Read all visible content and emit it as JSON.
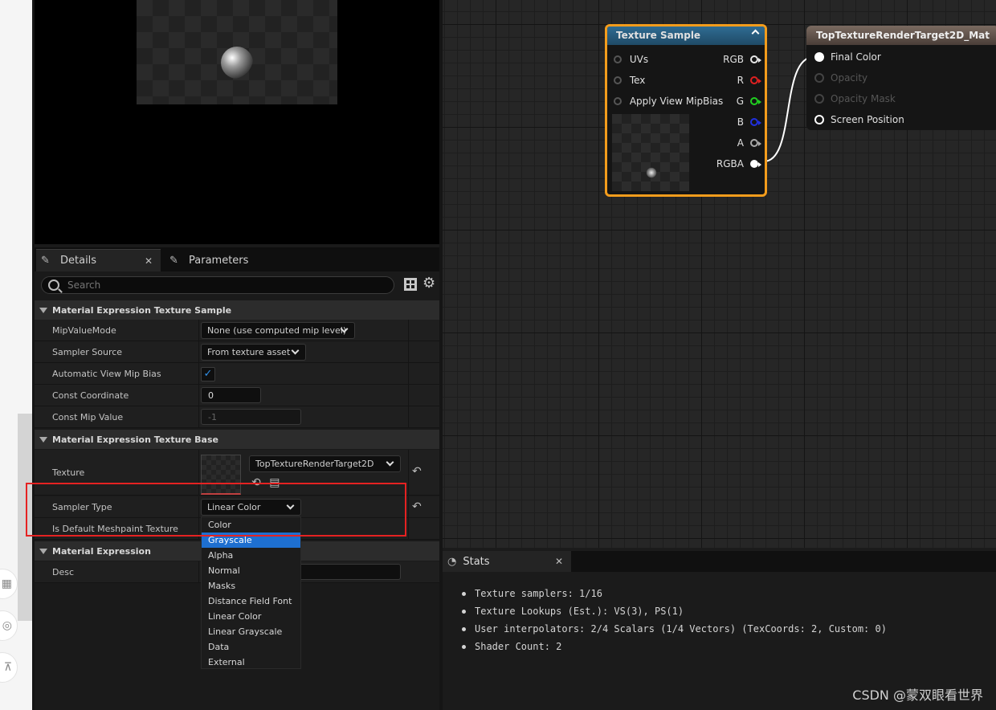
{
  "details_panel": {
    "tabs": [
      {
        "label": "Details",
        "icon": "pencil-icon"
      },
      {
        "label": "Parameters",
        "icon": "pencil-icon"
      }
    ],
    "search_placeholder": "Search",
    "sections": {
      "texture_sample": {
        "title": "Material Expression Texture Sample",
        "rows": {
          "mip_value_mode": {
            "label": "MipValueMode",
            "value": "None (use computed mip level)"
          },
          "sampler_source": {
            "label": "Sampler Source",
            "value": "From texture asset"
          },
          "auto_mip_bias": {
            "label": "Automatic View Mip Bias",
            "checked": true
          },
          "const_coordinate": {
            "label": "Const Coordinate",
            "value": "0"
          },
          "const_mip_value": {
            "label": "Const Mip Value",
            "value": "-1"
          }
        }
      },
      "texture_base": {
        "title": "Material Expression Texture Base",
        "rows": {
          "texture": {
            "label": "Texture",
            "value": "TopTextureRenderTarget2D"
          },
          "sampler_type": {
            "label": "Sampler Type",
            "value": "Linear Color"
          },
          "is_default_meshpaint": {
            "label": "Is Default Meshpaint Texture"
          }
        }
      },
      "material_expression": {
        "title": "Material Expression",
        "rows": {
          "desc": {
            "label": "Desc",
            "value": ""
          }
        }
      }
    },
    "sampler_type_options": [
      "Color",
      "Grayscale",
      "Alpha",
      "Normal",
      "Masks",
      "Distance Field Font",
      "Linear Color",
      "Linear Grayscale",
      "Data",
      "External"
    ],
    "highlighted_option": "Grayscale"
  },
  "graph": {
    "texture_sample_node": {
      "title": "Texture Sample",
      "inputs": [
        "UVs",
        "Tex",
        "Apply View MipBias"
      ],
      "outputs": [
        {
          "label": "RGB",
          "color": "#e8e8e8"
        },
        {
          "label": "R",
          "color": "#e02020"
        },
        {
          "label": "G",
          "color": "#20d020"
        },
        {
          "label": "B",
          "color": "#2030e0"
        },
        {
          "label": "A",
          "color": "#aaaaaa"
        },
        {
          "label": "RGBA",
          "color": "#ffffff"
        }
      ]
    },
    "output_node": {
      "title": "TopTextureRenderTarget2D_Mat",
      "pins": [
        {
          "label": "Final Color",
          "state": "connected"
        },
        {
          "label": "Opacity",
          "state": "disabled"
        },
        {
          "label": "Opacity Mask",
          "state": "disabled"
        },
        {
          "label": "Screen Position",
          "state": "open"
        }
      ]
    }
  },
  "stats": {
    "tab_label": "Stats",
    "lines": [
      "Texture samplers: 1/16",
      "Texture Lookups (Est.): VS(3), PS(1)",
      "User interpolators: 2/4 Scalars (1/4 Vectors) (TexCoords: 2, Custom: 0)",
      "Shader Count: 2"
    ]
  },
  "watermark": "CSDN @蒙双眼看世界"
}
